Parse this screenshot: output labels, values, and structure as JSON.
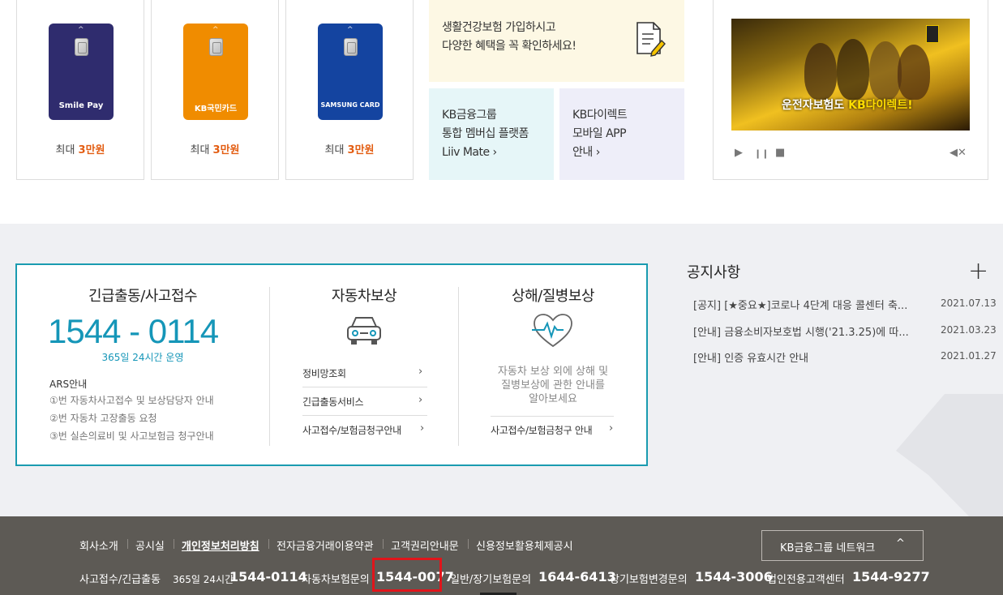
{
  "cards": [
    {
      "logo": "Smile Pay",
      "prefix": "최대",
      "amount": "3만원",
      "color": "#2f2c6e"
    },
    {
      "logo": "KB국민카드",
      "prefix": "최대",
      "amount": "3만원",
      "color": "#f08c00"
    },
    {
      "logo": "SAMSUNG CARD",
      "prefix": "최대",
      "amount": "3만원",
      "color": "#1444a0"
    }
  ],
  "promo_health": {
    "line1": "생활건강보험 가입하시고",
    "line2": "다양한 혜택을 꼭 확인하세요!"
  },
  "promo_liiv": {
    "line1": "KB금융그룹",
    "line2": "통합 멤버십 플랫폼",
    "line3": "Liiv Mate"
  },
  "promo_app": {
    "line1": "KB다이렉트",
    "line2": "모바일 APP",
    "line3": "안내"
  },
  "video": {
    "caption_a": "운전자보험도",
    "caption_b": "KB다이렉트!"
  },
  "emergency": {
    "title": "긴급출동/사고접수",
    "phone": "1544 - 0114",
    "hours": "365일 24시간 운영",
    "ars_title": "ARS안내",
    "ars": [
      "①번 자동차사고접수 및 보상담당자 안내",
      "②번 자동차 고장출동 요청",
      "③번 실손의료비 및 사고보험금 청구안내"
    ]
  },
  "auto_comp": {
    "title": "자동차보상",
    "links": [
      "정비망조회",
      "긴급출동서비스",
      "사고접수/보험금청구안내"
    ]
  },
  "injury_comp": {
    "title": "상해/질병보상",
    "desc1": "자동차 보상 외에 상해 및",
    "desc2": "질병보상에 관한 안내를",
    "desc3": "알아보세요",
    "link": "사고접수/보험금청구 안내"
  },
  "notice": {
    "title": "공지사항",
    "items": [
      {
        "text": "[공지] [★중요★]코로나 4단계 대응 콜센터 축...",
        "date": "2021.07.13"
      },
      {
        "text": "[안내] 금융소비자보호법 시행('21.3.25)에 따...",
        "date": "2021.03.23"
      },
      {
        "text": "[안내] 인증 유효시간 안내",
        "date": "2021.01.27"
      }
    ]
  },
  "footer": {
    "links": [
      "회사소개",
      "공시실",
      "개인정보처리방침",
      "전자금융거래이용약관",
      "고객권리안내문",
      "신용정보활용체제공시"
    ],
    "network": "KB금융그룹 네트워크",
    "phones": {
      "accident_label": "사고접수/긴급출동",
      "accident_hours": "365일 24시간",
      "accident_num": "1544-0114",
      "auto_label": "자동차보험문의",
      "auto_num": "1544-0077",
      "general_label": "일반/장기보험문의",
      "general_num": "1644-6413",
      "longterm_label": "장기보험변경문의",
      "longterm_num": "1544-3006",
      "corp_label": "법인전용고객센터",
      "corp_num": "1544-9277"
    }
  }
}
